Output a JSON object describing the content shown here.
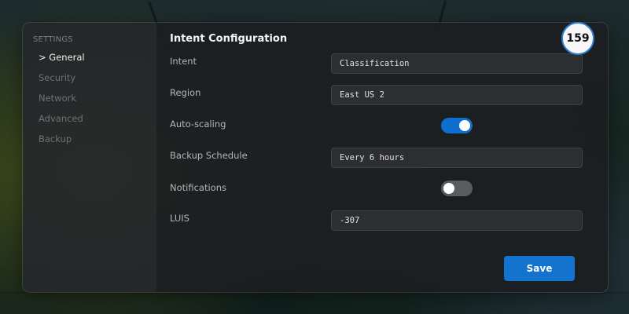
{
  "sidebar": {
    "heading": "SETTINGS",
    "items": [
      {
        "label": "> General",
        "active": true
      },
      {
        "label": "Security",
        "active": false
      },
      {
        "label": "Network",
        "active": false
      },
      {
        "label": "Advanced",
        "active": false
      },
      {
        "label": "Backup",
        "active": false
      }
    ]
  },
  "main": {
    "title": "Intent Configuration",
    "rows": [
      {
        "label": "Intent",
        "type": "input",
        "value": "Classification"
      },
      {
        "label": "Region",
        "type": "input",
        "value": "East US 2"
      },
      {
        "label": "Auto-scaling",
        "type": "toggle",
        "checked": true
      },
      {
        "label": "Backup Schedule",
        "type": "input",
        "value": "Every 6 hours"
      },
      {
        "label": "Notifications",
        "type": "toggle",
        "checked": false
      },
      {
        "label": "LUIS",
        "type": "input",
        "value": "-307"
      }
    ],
    "save_label": "Save"
  },
  "badge": {
    "count": "159"
  },
  "colors": {
    "accent": "#1573d0",
    "toggle_on": "#0f6fd0",
    "toggle_off": "#5a5c5f",
    "badge_ring": "#2f7fd4"
  }
}
